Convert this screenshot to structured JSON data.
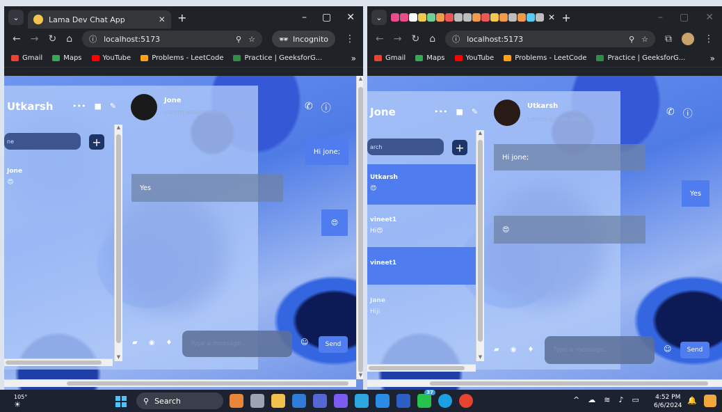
{
  "left_window": {
    "tab_title": "Lama Dev Chat App",
    "url": "localhost:5173",
    "incognito_label": "Incognito",
    "bookmarks": [
      "Gmail",
      "Maps",
      "YouTube",
      "Problems - LeetCode",
      "Practice | GeeksforG..."
    ],
    "sidebar": {
      "user_name": "Utkarsh",
      "search_partial": "ne",
      "contacts": [
        {
          "name": "Jone",
          "last_message": "😍"
        }
      ]
    },
    "chat": {
      "contact_name": "Jone",
      "contact_desc": "Lorem ipsum dolor sit amet",
      "messages": [
        {
          "text": "Hi jone;",
          "own": true
        },
        {
          "text": "Yes",
          "own": false
        },
        {
          "text": "😍",
          "own": true
        }
      ],
      "input_placeholder": "Type a message...",
      "send_label": "Send"
    }
  },
  "right_window": {
    "url": "localhost:5173",
    "bookmarks": [
      "Gmail",
      "Maps",
      "YouTube",
      "Problems - LeetCode",
      "Practice | GeeksforG..."
    ],
    "sidebar": {
      "user_name": "Jone",
      "search_partial": "arch",
      "contacts": [
        {
          "name": "Utkarsh",
          "last_message": "😍",
          "active": true
        },
        {
          "name": "vineet1",
          "last_message": "Hi😍",
          "active": false
        },
        {
          "name": "vineet1",
          "last_message": "",
          "active": true
        },
        {
          "name": "Jane",
          "last_message": "Hiji",
          "active": false
        }
      ]
    },
    "chat": {
      "contact_name": "Utkarsh",
      "contact_desc": "Lorem ipsum dolor sit amet",
      "messages": [
        {
          "text": "Hi jone;",
          "own": false
        },
        {
          "text": "Yes",
          "own": true
        },
        {
          "text": "😍",
          "own": false
        }
      ],
      "input_placeholder": "Type a message...",
      "send_label": "Send"
    }
  },
  "taskbar": {
    "weather": "105°",
    "search_label": "Search",
    "whatsapp_badge": "37",
    "time": "4:52 PM",
    "date": "6/6/2024"
  },
  "colors": {
    "accent": "#4f7df0",
    "chrome_dark": "#1f2227",
    "taskbar": "#1c2230"
  }
}
